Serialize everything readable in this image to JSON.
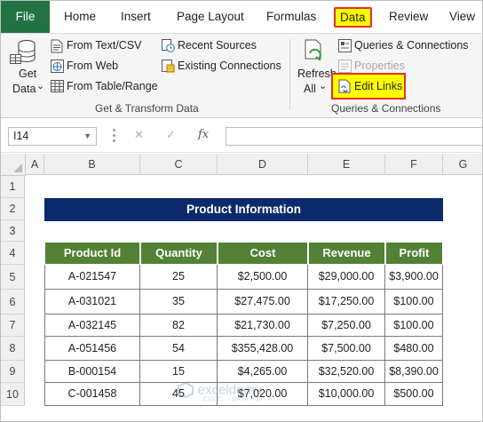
{
  "menu": {
    "tabs": [
      {
        "id": "file",
        "label": "File"
      },
      {
        "id": "home",
        "label": "Home"
      },
      {
        "id": "insert",
        "label": "Insert"
      },
      {
        "id": "page_layout",
        "label": "Page Layout"
      },
      {
        "id": "formulas",
        "label": "Formulas"
      },
      {
        "id": "data",
        "label": "Data"
      },
      {
        "id": "review",
        "label": "Review"
      },
      {
        "id": "view",
        "label": "View"
      }
    ]
  },
  "ribbon": {
    "get_data": {
      "line1": "Get",
      "line2": "Data",
      "chevron": "⌄"
    },
    "from_text_csv": "From Text/CSV",
    "from_web": "From Web",
    "from_table_range": "From Table/Range",
    "recent_sources": "Recent Sources",
    "existing_connections": "Existing Connections",
    "group1_label": "Get & Transform Data",
    "refresh_all": {
      "line1": "Refresh",
      "line2": "All",
      "chevron": "⌄"
    },
    "queries_connections": "Queries & Connections",
    "properties": "Properties",
    "edit_links": "Edit Links",
    "group2_label": "Queries & Connections",
    "highlight_color": "#ffff00",
    "highlight_border": "#e0302c"
  },
  "formula_bar": {
    "name_box": "I14",
    "fx_symbol": "fx",
    "cancel_symbol": "✕",
    "enter_symbol": "✓",
    "formula": ""
  },
  "sheet": {
    "columns": [
      "A",
      "B",
      "C",
      "D",
      "E",
      "F",
      "G"
    ],
    "rows": [
      "1",
      "2",
      "3",
      "4",
      "5",
      "6",
      "7",
      "8",
      "9",
      "10"
    ],
    "title": "Product Information",
    "headers": [
      "Product Id",
      "Quantity",
      "Cost",
      "Revenue",
      "Profit"
    ],
    "data": [
      [
        "A-021547",
        "25",
        "$2,500.00",
        "$29,000.00",
        "$3,900.00"
      ],
      [
        "A-031021",
        "35",
        "$27,475.00",
        "$17,250.00",
        "$100.00"
      ],
      [
        "A-032145",
        "82",
        "$21,730.00",
        "$7,250.00",
        "$100.00"
      ],
      [
        "A-051456",
        "54",
        "$355,428.00",
        "$7,500.00",
        "$480.00"
      ],
      [
        "B-000154",
        "15",
        "$4,265.00",
        "$32,520.00",
        "$8,390.00"
      ],
      [
        "C-001458",
        "45",
        "$7,020.00",
        "$10,000.00",
        "$500.00"
      ]
    ],
    "header_color": "#538135",
    "title_color": "#0b2a6b"
  },
  "watermark": {
    "name": "exceldemy",
    "tagline": "EXCEL · DATA · BI"
  }
}
